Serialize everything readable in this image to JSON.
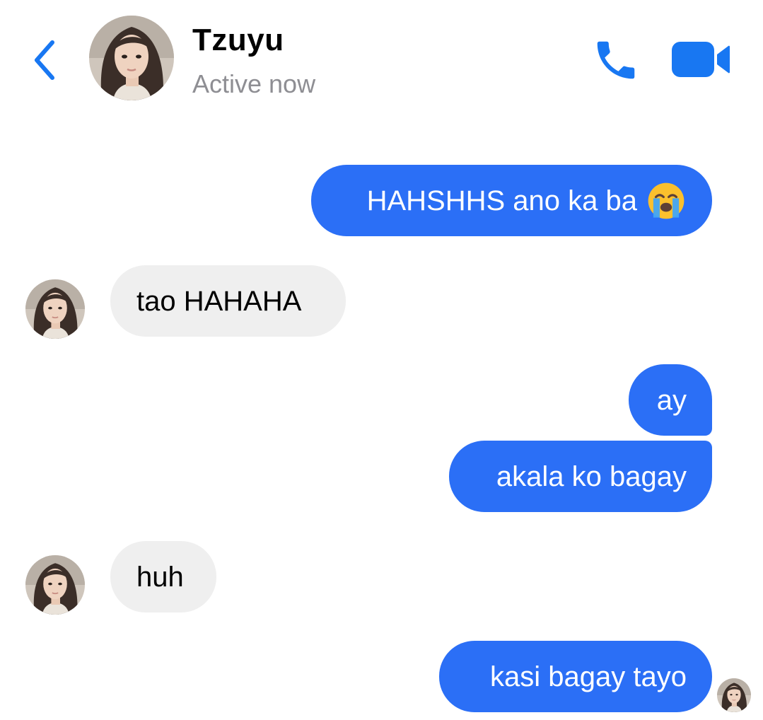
{
  "header": {
    "contact_name": "Tzuyu",
    "status": "Active now"
  },
  "messages": [
    {
      "direction": "outgoing",
      "text": "HAHSHHS ano ka ba",
      "emoji": "loudly-crying-face-icon"
    },
    {
      "direction": "incoming",
      "text": "tao HAHAHA"
    },
    {
      "direction": "outgoing",
      "text": "ay"
    },
    {
      "direction": "outgoing",
      "text": "akala ko bagay"
    },
    {
      "direction": "incoming",
      "text": "huh"
    },
    {
      "direction": "outgoing",
      "text": "kasi bagay tayo"
    }
  ],
  "colors": {
    "accent": "#2b6ff6",
    "icon_blue": "#1877f2",
    "incoming_bubble": "#efefef",
    "status_gray": "#8e8e93"
  }
}
